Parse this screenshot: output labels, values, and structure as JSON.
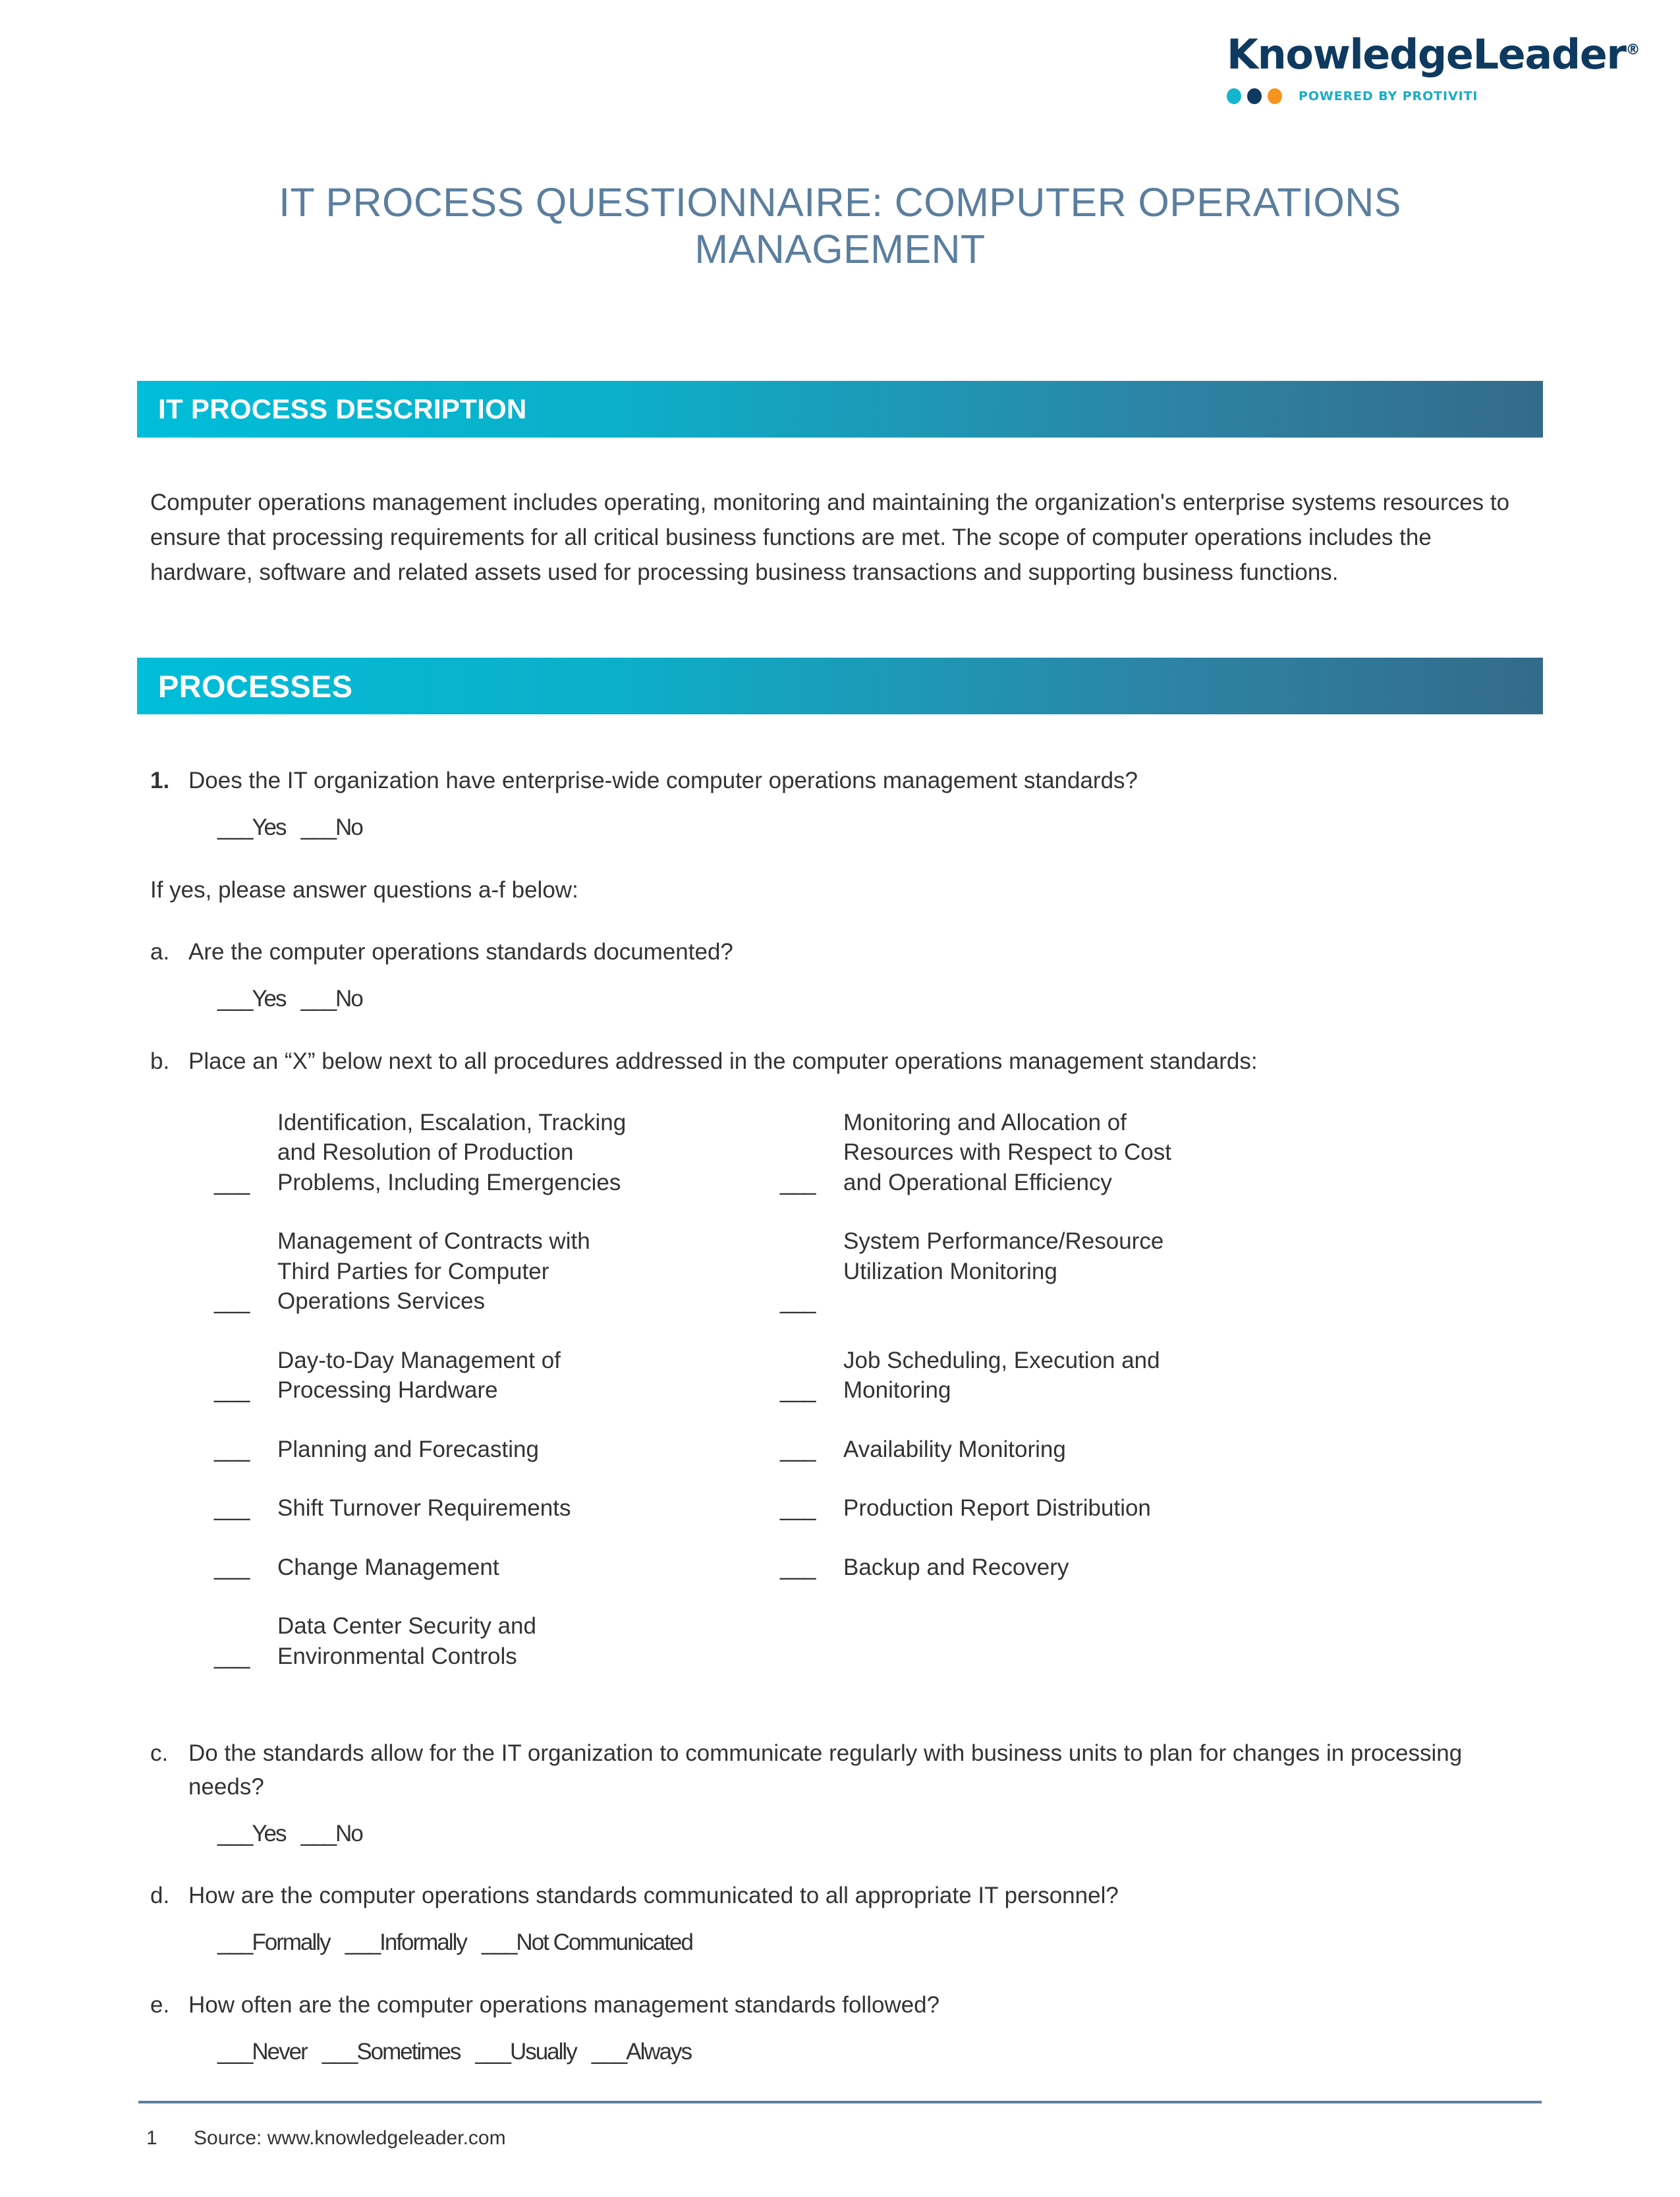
{
  "logo": {
    "wordmark": "KnowledgeLeader",
    "registered": "®",
    "tagline": "POWERED BY PROTIVITI",
    "dot_colors": [
      "#13b5cf",
      "#0f3a60",
      "#f7941e"
    ],
    "wordmark_color": "#0f3a60",
    "tagline_color": "#18acc8"
  },
  "document": {
    "title": "IT PROCESS QUESTIONNAIRE: COMPUTER OPERATIONS MANAGEMENT",
    "title_color": "#5b7e9e"
  },
  "sections": {
    "description": {
      "heading": "IT PROCESS DESCRIPTION",
      "body": "Computer operations management includes operating, monitoring and maintaining the organization's enterprise systems resources to ensure that processing requirements for all critical business functions are met. The scope of computer operations includes the hardware, software and related assets used for processing business transactions and supporting business functions."
    },
    "processes": {
      "heading": "PROCESSES"
    }
  },
  "bar_gradient": {
    "from": "#00bdd9",
    "to": "#336b8a"
  },
  "blank": "___",
  "questions": {
    "q1": {
      "number": "1.",
      "text": "Does the IT organization have enterprise-wide computer operations management standards?",
      "answers": "___Yes   ___No"
    },
    "if_yes_note": "If yes, please answer questions a-f below:",
    "a": {
      "letter": "a.",
      "text": "Are the computer operations standards documented?",
      "answers": "___Yes   ___No"
    },
    "b": {
      "letter": "b.",
      "text": "Place an “X” below next to all procedures addressed in the computer operations management standards:"
    },
    "c": {
      "letter": "c.",
      "text": "Do the standards allow for the IT organization to communicate regularly with business units to plan for changes in processing needs?",
      "answers": "___Yes   ___No"
    },
    "d": {
      "letter": "d.",
      "text": "How are the computer operations standards communicated to all appropriate IT personnel?",
      "answers": "___Formally   ___Informally   ___Not Communicated"
    },
    "e": {
      "letter": "e.",
      "text": "How often are the computer operations management standards followed?",
      "answers": "___Never   ___Sometimes   ___Usually   ___Always"
    }
  },
  "checklist": {
    "rows": [
      {
        "left": [
          "Identification, Escalation, Tracking",
          "and Resolution of Production",
          "Problems, Including Emergencies"
        ],
        "right": [
          "Monitoring and Allocation of",
          "Resources with Respect to Cost",
          "and Operational Efficiency"
        ]
      },
      {
        "left": [
          "Management of Contracts with",
          "Third Parties for Computer",
          "Operations Services"
        ],
        "right": [
          "System Performance/Resource",
          "Utilization Monitoring"
        ]
      },
      {
        "left": [
          "Day-to-Day Management of",
          "Processing Hardware"
        ],
        "right": [
          "Job Scheduling, Execution and",
          "Monitoring"
        ]
      },
      {
        "left": [
          "Planning and Forecasting"
        ],
        "right": [
          "Availability Monitoring"
        ]
      },
      {
        "left": [
          "Shift Turnover Requirements"
        ],
        "right": [
          "Production Report Distribution"
        ]
      },
      {
        "left": [
          "Change Management"
        ],
        "right": [
          "Backup and Recovery"
        ]
      },
      {
        "left": [
          "Data Center Security and",
          "Environmental Controls"
        ],
        "right": []
      }
    ]
  },
  "footer": {
    "page_number": "1",
    "source": "Source: www.knowledgeleader.com",
    "rule_color": "#5b7e9e"
  }
}
